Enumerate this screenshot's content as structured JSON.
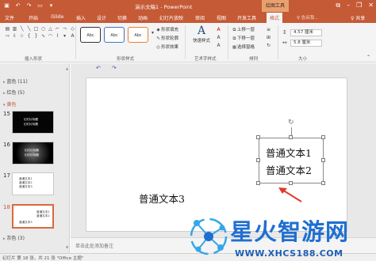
{
  "titlebar": {
    "title": "演示文稿1 - PowerPoint",
    "context_tab": "绘图工具",
    "qat_icons": [
      "save-icon",
      "undo-icon",
      "redo-icon",
      "start-slideshow-icon",
      "qat-more-icon"
    ],
    "window_buttons": [
      "ribbon-options-icon",
      "minimize-icon",
      "restore-icon",
      "close-icon"
    ]
  },
  "tabs": [
    {
      "label": "文件"
    },
    {
      "label": "开始"
    },
    {
      "label": "iSlide"
    },
    {
      "label": "插入"
    },
    {
      "label": "设计"
    },
    {
      "label": "切换"
    },
    {
      "label": "动画"
    },
    {
      "label": "幻灯片放映"
    },
    {
      "label": "审阅"
    },
    {
      "label": "视图"
    },
    {
      "label": "开发工具"
    },
    {
      "label": "格式",
      "active": true
    }
  ],
  "tell_me": "♀ 告诉我...",
  "share": "♀ 共享",
  "ribbon": {
    "groups": {
      "insert_shapes": "插入形状",
      "shape_styles": "形状样式",
      "wordart_styles": "艺术字样式",
      "arrange": "排列",
      "size": "大小"
    },
    "style_samples": [
      "Abc",
      "Abc",
      "Abc"
    ],
    "shape_fill": "形状填充",
    "shape_outline": "形状轮廓",
    "shape_effects": "形状效果",
    "quick_styles": "快速样式",
    "bring_forward": "上移一层",
    "send_backward": "下移一层",
    "selection_pane": "选择窗格",
    "height": "4.57 厘米",
    "width": "5.8 厘米"
  },
  "thumbnails": {
    "sections": [
      "蓝色 (11)",
      "红色 (5)",
      "黄色",
      "灰色 (3)"
    ],
    "slides": [
      {
        "num": "15",
        "line1": "幻灯片标题",
        "line2": "幻灯片标题"
      },
      {
        "num": "16",
        "line1": "幻灯片标题",
        "line2": "幻灯片标题"
      },
      {
        "num": "17",
        "line1": "普通文本1",
        "line2": "普通文本2",
        "line3": "普通文本3"
      },
      {
        "num": "18",
        "line1": "普通文本1",
        "line2": "普通文本2",
        "line3": "普通文本3"
      }
    ]
  },
  "slide": {
    "text1": "普通文本1",
    "text2": "普通文本2",
    "text3": "普通文本3"
  },
  "notes_placeholder": "单击此处添加备注",
  "status": "幻灯片 第 18 张，共 21 张   \"Office 主题\"",
  "watermark": {
    "name": "星火智游网",
    "url": "WWW.XHCS188.COM"
  }
}
